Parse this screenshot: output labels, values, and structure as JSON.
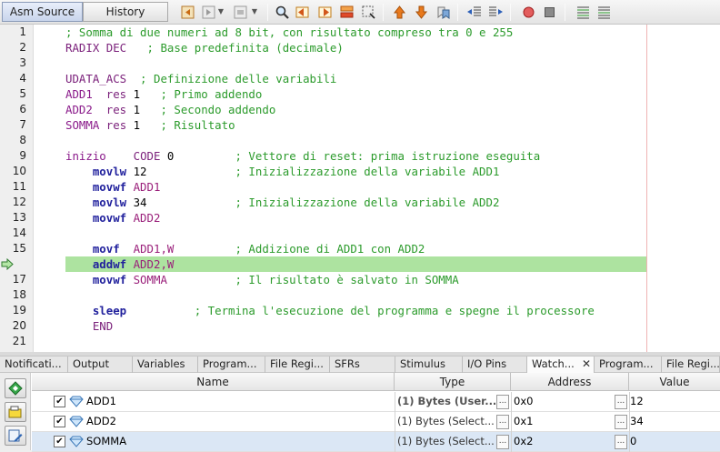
{
  "toolbar": {
    "tabs": [
      {
        "label": "Asm Source",
        "active": true
      },
      {
        "label": "History",
        "active": false
      }
    ],
    "icons": [
      "back-icon",
      "forward-icon",
      "last-edit-icon",
      "find-icon",
      "find-prev-icon",
      "find-next-icon",
      "find-selection-icon",
      "toggle-bookmark-icon",
      "previous-bookmark-icon",
      "next-bookmark-icon",
      "toggle-breakpoint-icon",
      "stop-macro-icon",
      "start-macro-icon",
      "shift-left-icon",
      "shift-right-icon",
      "record-icon",
      "stop-icon",
      "comment-icon"
    ]
  },
  "editor": {
    "current_line": 16,
    "lines": [
      {
        "no": "1",
        "segments": [
          {
            "t": "; Somma di due numeri ad 8 bit, con risultato compreso tra 0 e 255",
            "c": "cm"
          }
        ]
      },
      {
        "no": "2",
        "segments": [
          {
            "t": "RADIX DEC",
            "c": "dir"
          },
          {
            "t": "   ; Base predefinita (decimale)",
            "c": "cm"
          }
        ]
      },
      {
        "no": "3",
        "segments": []
      },
      {
        "no": "4",
        "segments": [
          {
            "t": "UDATA_ACS",
            "c": "dir"
          },
          {
            "t": "  ; Definizione delle variabili",
            "c": "cm"
          }
        ]
      },
      {
        "no": "5",
        "segments": [
          {
            "t": "ADD1",
            "c": "lab"
          },
          {
            "t": "  res ",
            "c": "dir"
          },
          {
            "t": "1",
            "c": "txt"
          },
          {
            "t": "   ; Primo addendo",
            "c": "cm"
          }
        ]
      },
      {
        "no": "6",
        "segments": [
          {
            "t": "ADD2",
            "c": "lab"
          },
          {
            "t": "  res ",
            "c": "dir"
          },
          {
            "t": "1",
            "c": "txt"
          },
          {
            "t": "   ; Secondo addendo",
            "c": "cm"
          }
        ]
      },
      {
        "no": "7",
        "segments": [
          {
            "t": "SOMMA",
            "c": "lab"
          },
          {
            "t": " res ",
            "c": "dir"
          },
          {
            "t": "1",
            "c": "txt"
          },
          {
            "t": "   ; Risultato",
            "c": "cm"
          }
        ]
      },
      {
        "no": "8",
        "segments": []
      },
      {
        "no": "9",
        "segments": [
          {
            "t": "inizio",
            "c": "lab"
          },
          {
            "t": "    CODE ",
            "c": "dir"
          },
          {
            "t": "0",
            "c": "txt"
          },
          {
            "t": "         ; Vettore di reset: prima istruzione eseguita",
            "c": "cm"
          }
        ]
      },
      {
        "no": "10",
        "segments": [
          {
            "t": "    movlw",
            "c": "ins"
          },
          {
            "t": " 12",
            "c": "txt"
          },
          {
            "t": "             ; Inizializzazione della variabile ADD1",
            "c": "cm"
          }
        ]
      },
      {
        "no": "11",
        "segments": [
          {
            "t": "    movwf",
            "c": "ins"
          },
          {
            "t": " ADD1",
            "c": "op"
          }
        ]
      },
      {
        "no": "12",
        "segments": [
          {
            "t": "    movlw",
            "c": "ins"
          },
          {
            "t": " 34",
            "c": "txt"
          },
          {
            "t": "             ; Inizializzazione della variabile ADD2",
            "c": "cm"
          }
        ]
      },
      {
        "no": "13",
        "segments": [
          {
            "t": "    movwf",
            "c": "ins"
          },
          {
            "t": " ADD2",
            "c": "op"
          }
        ]
      },
      {
        "no": "14",
        "segments": []
      },
      {
        "no": "15",
        "segments": [
          {
            "t": "    movf",
            "c": "ins"
          },
          {
            "t": "  ADD1,W",
            "c": "op"
          },
          {
            "t": "         ; Addizione di ADD1 con ADD2",
            "c": "cm"
          }
        ]
      },
      {
        "no": "16",
        "segments": [
          {
            "t": "    addwf",
            "c": "ins"
          },
          {
            "t": " ADD2,W",
            "c": "op"
          }
        ]
      },
      {
        "no": "17",
        "segments": [
          {
            "t": "    movwf",
            "c": "ins"
          },
          {
            "t": " SOMMA",
            "c": "op"
          },
          {
            "t": "          ; Il risultato è salvato in SOMMA",
            "c": "cm"
          }
        ]
      },
      {
        "no": "18",
        "segments": []
      },
      {
        "no": "19",
        "segments": [
          {
            "t": "    sleep",
            "c": "ins"
          },
          {
            "t": "          ; Termina l'esecuzione del programma e spegne il processore",
            "c": "cm"
          }
        ]
      },
      {
        "no": "20",
        "segments": [
          {
            "t": "    END",
            "c": "dir"
          }
        ]
      },
      {
        "no": "21",
        "segments": []
      }
    ]
  },
  "bottom_tabs": [
    {
      "label": "Notificati...",
      "active": false
    },
    {
      "label": "Output",
      "active": false
    },
    {
      "label": "Variables",
      "active": false
    },
    {
      "label": "Program...",
      "active": false
    },
    {
      "label": "File Regi...",
      "active": false
    },
    {
      "label": "SFRs",
      "active": false
    },
    {
      "label": "Stimulus",
      "active": false
    },
    {
      "label": "I/O Pins",
      "active": false
    },
    {
      "label": "Watch...",
      "active": true,
      "close": "✕"
    },
    {
      "label": "Program...",
      "active": false
    },
    {
      "label": "File Regi...",
      "active": false
    }
  ],
  "watches": {
    "columns": {
      "name": "Name",
      "type": "Type",
      "address": "Address",
      "value": "Value"
    },
    "dots_label": "...",
    "rows": [
      {
        "name": "ADD1",
        "type": "(1) Bytes (User...",
        "type_bold": true,
        "address": "0x0",
        "value": "12",
        "checked": true,
        "selected": false
      },
      {
        "name": "ADD2",
        "type": "(1) Bytes (Select...",
        "type_bold": false,
        "address": "0x1",
        "value": "34",
        "checked": true,
        "selected": false
      },
      {
        "name": "SOMMA",
        "type": "(1) Bytes (Select...",
        "type_bold": false,
        "address": "0x2",
        "value": "0",
        "checked": true,
        "selected": true
      }
    ],
    "side_buttons": [
      "new-watch-icon",
      "new-runtime-watch-icon",
      "watch-options-icon"
    ]
  },
  "colors": {
    "comment": "#2c9b2c",
    "directive": "#7a1f7a",
    "instruction": "#21219d",
    "highlight": "#ade3a0",
    "margin": "#f0b4b4",
    "selection": "#dbe7f5"
  }
}
